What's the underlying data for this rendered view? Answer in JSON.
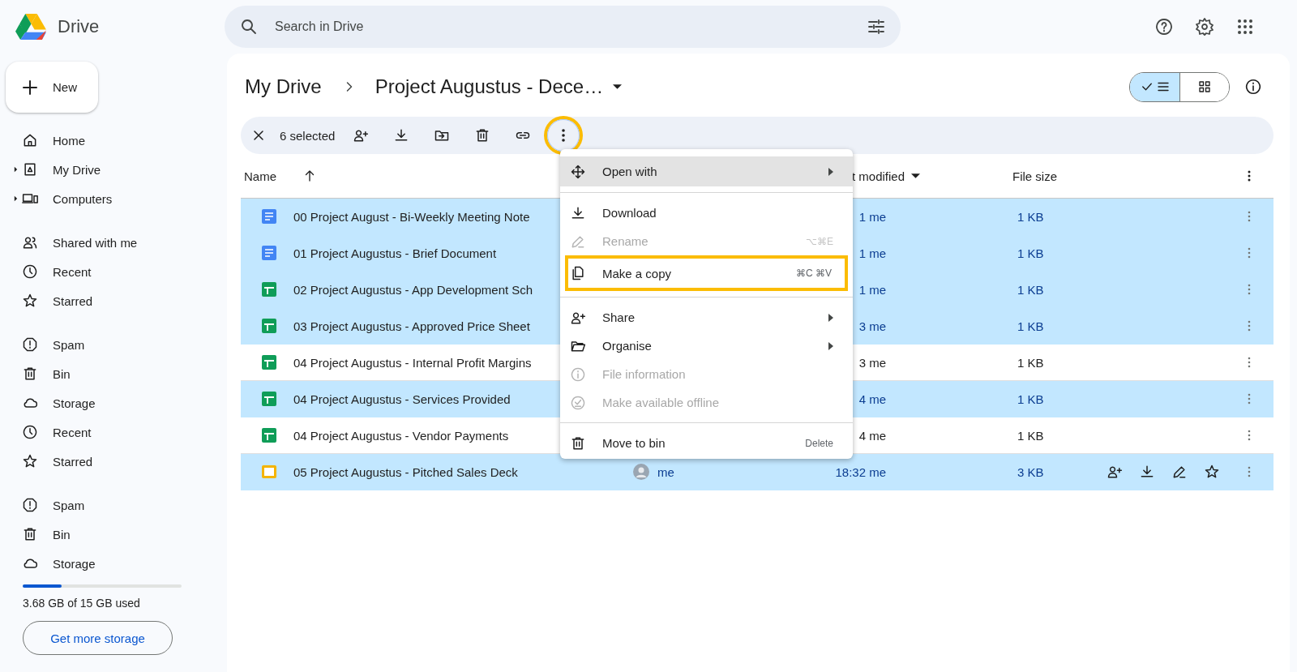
{
  "app": {
    "name": "Drive"
  },
  "search": {
    "placeholder": "Search in Drive"
  },
  "top_actions": [
    {
      "kind": "help"
    },
    {
      "kind": "settings"
    },
    {
      "kind": "apps"
    }
  ],
  "new_button": {
    "label": "New"
  },
  "sidebar": {
    "groups": [
      [
        {
          "kind": "home",
          "label": "Home",
          "expandable": false
        },
        {
          "kind": "drive",
          "label": "My Drive",
          "expandable": true
        },
        {
          "kind": "computers",
          "label": "Computers",
          "expandable": true
        }
      ],
      [
        {
          "kind": "shared",
          "label": "Shared with me",
          "expandable": false
        },
        {
          "kind": "recent",
          "label": "Recent",
          "expandable": false
        },
        {
          "kind": "starred",
          "label": "Starred",
          "expandable": false
        }
      ],
      [
        {
          "kind": "spam",
          "label": "Spam",
          "expandable": false
        },
        {
          "kind": "bin",
          "label": "Bin",
          "expandable": false
        },
        {
          "kind": "storage",
          "label": "Storage",
          "expandable": false
        },
        {
          "kind": "recent",
          "label": "Recent",
          "expandable": false
        },
        {
          "kind": "starred",
          "label": "Starred",
          "expandable": false
        }
      ],
      [
        {
          "kind": "spam",
          "label": "Spam",
          "expandable": false
        },
        {
          "kind": "bin",
          "label": "Bin",
          "expandable": false
        },
        {
          "kind": "storage",
          "label": "Storage",
          "expandable": false
        }
      ]
    ]
  },
  "storage": {
    "level": 0.245,
    "text": "3.68 GB of 15 GB used",
    "button": "Get more storage"
  },
  "breadcrumb": {
    "parent": "My Drive",
    "current": "Project Augustus - Dece…"
  },
  "view_toggle": [
    {
      "kind": "list",
      "selected": true
    },
    {
      "kind": "grid",
      "selected": false
    }
  ],
  "selection_bar": {
    "count": "6 selected",
    "actions": [
      {
        "kind": "add-person",
        "highlighted": false
      },
      {
        "kind": "download",
        "highlighted": false
      },
      {
        "kind": "move",
        "highlighted": false
      },
      {
        "kind": "bin",
        "highlighted": false
      },
      {
        "kind": "link",
        "highlighted": false
      },
      {
        "kind": "more",
        "highlighted": true
      }
    ]
  },
  "table": {
    "columns": [
      {
        "label": "Name",
        "kind": "sort-up"
      },
      {
        "label": "t modified",
        "kind": "sort-down"
      },
      {
        "label": "File size",
        "kind": "plain"
      }
    ],
    "rows": [
      {
        "kind": "doc",
        "name": "00 Project August - Bi-Weekly Meeting Note",
        "selected": true,
        "modified": "1 me",
        "size": "1 KB",
        "hovered": false
      },
      {
        "kind": "doc",
        "name": "01 Project Augustus - Brief Document",
        "selected": true,
        "modified": "1 me",
        "size": "1 KB",
        "hovered": false
      },
      {
        "kind": "sheet",
        "name": "02 Project Augustus - App Development Sch",
        "selected": true,
        "modified": "1 me",
        "size": "1 KB",
        "hovered": false
      },
      {
        "kind": "sheet",
        "name": "03 Project Augustus - Approved Price Sheet",
        "selected": true,
        "modified": "3 me",
        "size": "1 KB",
        "hovered": false
      },
      {
        "kind": "sheet",
        "name": "04 Project Augustus - Internal Profit Margins",
        "selected": false,
        "modified": "3 me",
        "size": "1 KB",
        "hovered": false
      },
      {
        "kind": "sheet",
        "name": "04 Project Augustus - Services Provided",
        "selected": true,
        "modified": "4 me",
        "size": "1 KB",
        "hovered": false
      },
      {
        "kind": "sheet",
        "name": "04 Project Augustus - Vendor Payments",
        "selected": false,
        "modified": "4 me",
        "size": "1 KB",
        "hovered": false
      },
      {
        "kind": "slides",
        "name": "05 Project Augustus - Pitched Sales Deck",
        "selected": true,
        "owner": "me",
        "modified": "18:32 me",
        "size": "3 KB",
        "hovered": true
      }
    ]
  },
  "menu": {
    "groups": [
      [
        {
          "kind": "open-with",
          "label": "Open with",
          "submenu": true,
          "hovered": true,
          "disabled": false,
          "annotated": false
        }
      ],
      [
        {
          "kind": "download",
          "label": "Download",
          "submenu": false,
          "hovered": false,
          "disabled": false,
          "annotated": false
        },
        {
          "kind": "rename",
          "label": "Rename",
          "shortcut": "⌥⌘E",
          "submenu": false,
          "hovered": false,
          "disabled": true,
          "annotated": false
        },
        {
          "kind": "copy",
          "label": "Make a copy",
          "shortcut": "⌘C ⌘V",
          "submenu": false,
          "hovered": false,
          "disabled": false,
          "annotated": true
        }
      ],
      [
        {
          "kind": "add-person",
          "label": "Share",
          "submenu": true,
          "hovered": false,
          "disabled": false,
          "annotated": false
        },
        {
          "kind": "organise",
          "label": "Organise",
          "submenu": true,
          "hovered": false,
          "disabled": false,
          "annotated": false
        },
        {
          "kind": "info",
          "label": "File information",
          "submenu": false,
          "hovered": false,
          "disabled": true,
          "annotated": false
        },
        {
          "kind": "offline",
          "label": "Make available offline",
          "submenu": false,
          "hovered": false,
          "disabled": true,
          "annotated": false
        }
      ],
      [
        {
          "kind": "bin",
          "label": "Move to bin",
          "shortcut": "Delete",
          "submenu": false,
          "hovered": false,
          "disabled": false,
          "annotated": false
        }
      ]
    ]
  }
}
